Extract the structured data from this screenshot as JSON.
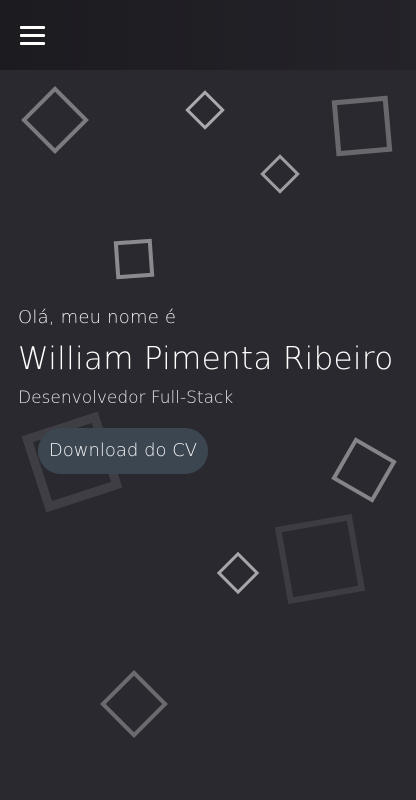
{
  "navbar": {
    "menu_icon": "hamburger-menu-icon"
  },
  "hero": {
    "greeting": "Olá, meu nome é",
    "name": "William Pimenta Ribeiro",
    "role": "Desenvolvedor Full-Stack",
    "download_label": "Download do CV"
  },
  "theme": {
    "background": "#2a2930",
    "navbar_background": "#1c1b20",
    "button_background": "#3c4650",
    "text": "#ffffff",
    "decor_square": "#8b8a8e"
  }
}
